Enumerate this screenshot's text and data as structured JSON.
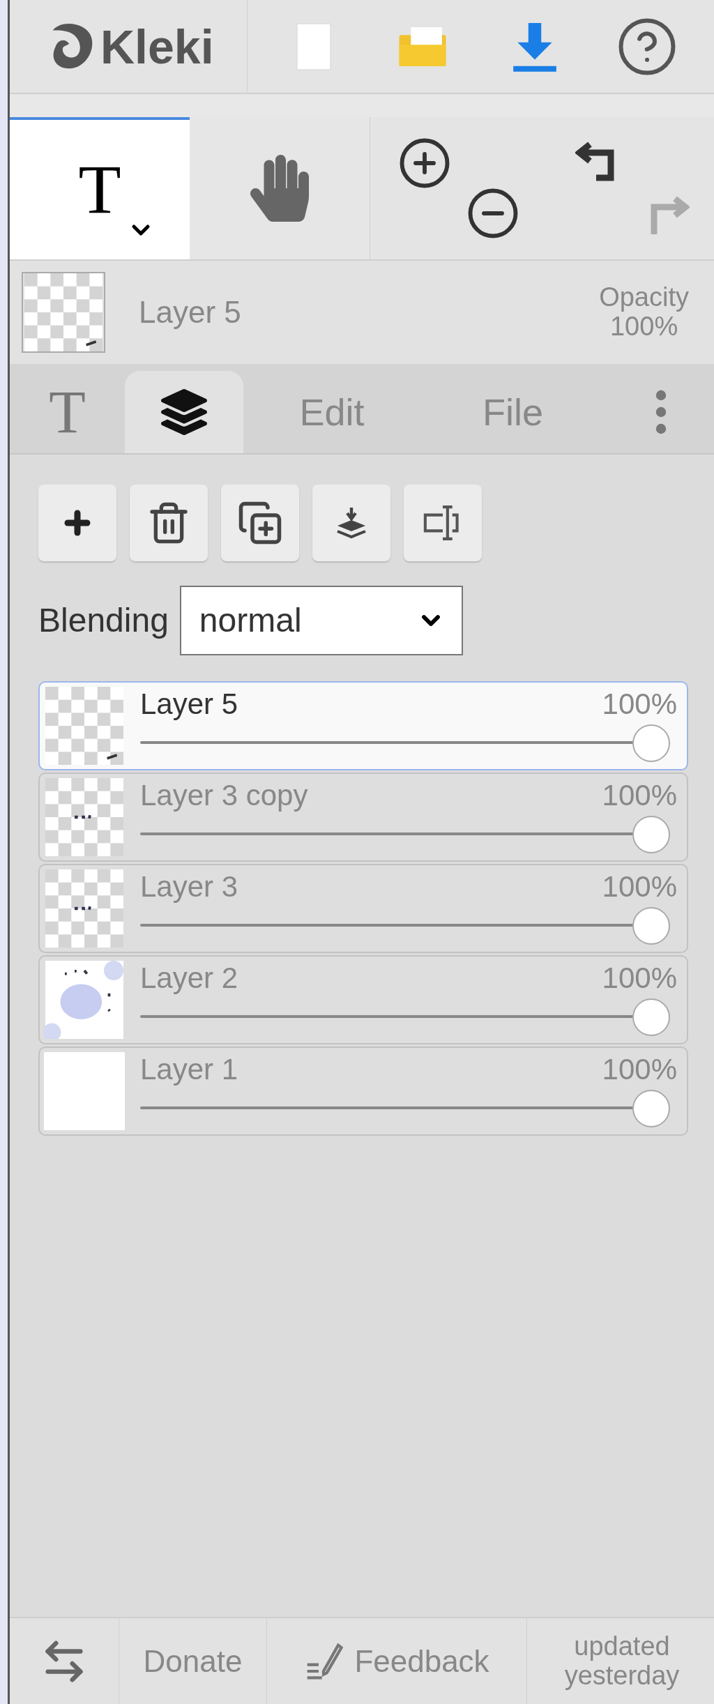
{
  "header": {
    "logo": "Kleki"
  },
  "tools": [
    {
      "kind": "text",
      "glyph": "T",
      "selected": true
    },
    {
      "kind": "hand",
      "selected": false
    }
  ],
  "active_layer": {
    "name": "Layer 5",
    "opacity_label": "Opacity",
    "opacity": "100%"
  },
  "tabs": [
    {
      "kind": "glyph",
      "label": "T",
      "selected": false
    },
    {
      "kind": "layers",
      "selected": true
    },
    {
      "kind": "text",
      "label": "Edit",
      "selected": false
    },
    {
      "kind": "text",
      "label": "File",
      "selected": false
    },
    {
      "kind": "more",
      "selected": false
    }
  ],
  "blending": {
    "label": "Blending",
    "value": "normal"
  },
  "layers": [
    {
      "name": "Layer 5",
      "opacity": "100%",
      "level": 1,
      "selected": true,
      "kind": "transparent"
    },
    {
      "name": "Layer 3 copy",
      "opacity": "100%",
      "level": 1,
      "selected": false,
      "kind": "marks"
    },
    {
      "name": "Layer 3",
      "opacity": "100%",
      "level": 1,
      "selected": false,
      "kind": "marks"
    },
    {
      "name": "Layer 2",
      "opacity": "100%",
      "level": 1,
      "selected": false,
      "kind": "drawing"
    },
    {
      "name": "Layer 1",
      "opacity": "100%",
      "level": 1,
      "selected": false,
      "kind": "white"
    }
  ],
  "footer": {
    "donate": "Donate",
    "feedback": "Feedback",
    "updated": "updated yesterday"
  }
}
